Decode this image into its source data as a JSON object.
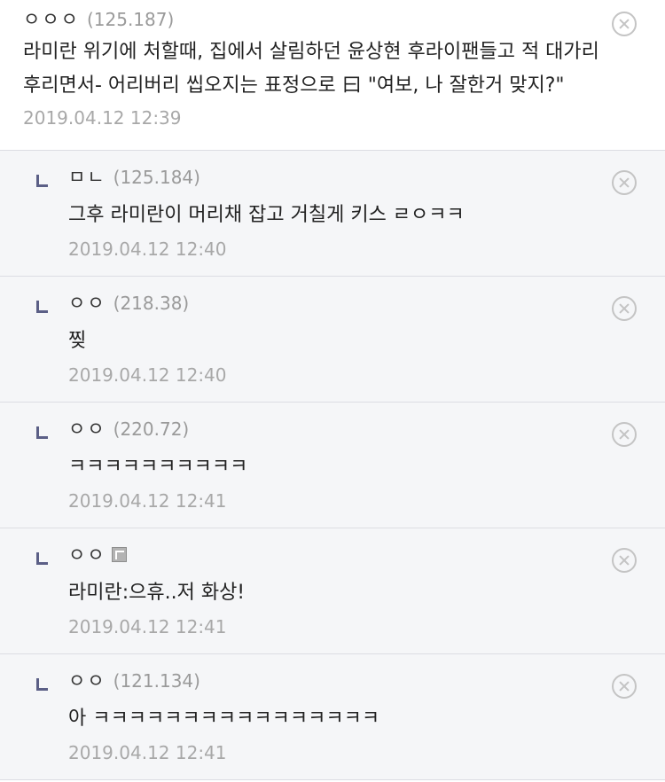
{
  "comments": [
    {
      "nickname": "ㅇㅇㅇ",
      "ip": "(125.187)",
      "text": "라미란 위기에 처할때, 집에서 살림하던 윤상현 후라이팬들고 적 대가리 후리면서- 어리버리 씹오지는 표정으로 曰 \"여보, 나 잘한거 맞지?\"",
      "timestamp": "2019.04.12 12:39"
    }
  ],
  "replies": [
    {
      "nickname": "ㅁㄴ",
      "ip": "(125.184)",
      "text": "그후 라미란이 머리채 잡고 거칠게 키스 ㄹㅇㅋㅋ",
      "timestamp": "2019.04.12 12:40"
    },
    {
      "nickname": "ㅇㅇ",
      "ip": "(218.38)",
      "text": "찢",
      "timestamp": "2019.04.12 12:40"
    },
    {
      "nickname": "ㅇㅇ",
      "ip": "(220.72)",
      "text": "ㅋㅋㅋㅋㅋㅋㅋㅋㅋㅋ",
      "timestamp": "2019.04.12 12:41"
    },
    {
      "nickname": "ㅇㅇ",
      "ip": "",
      "badge_icon": "fixed-nick-icon",
      "text": "라미란:으휴..저 화상!",
      "timestamp": "2019.04.12 12:41"
    },
    {
      "nickname": "ㅇㅇ",
      "ip": "(121.134)",
      "text": "아 ㅋㅋㅋㅋㅋㅋㅋㅋㅋㅋㅋㅋㅋㅋㅋㅋ",
      "timestamp": "2019.04.12 12:41"
    }
  ],
  "icons": {
    "delete": "close-circle-icon",
    "reply_marker": "reply-arrow-icon"
  },
  "colors": {
    "reply_background": "#f5f6f8",
    "reply_marker": "#5b5f86",
    "muted_text": "#a8a8a8"
  }
}
